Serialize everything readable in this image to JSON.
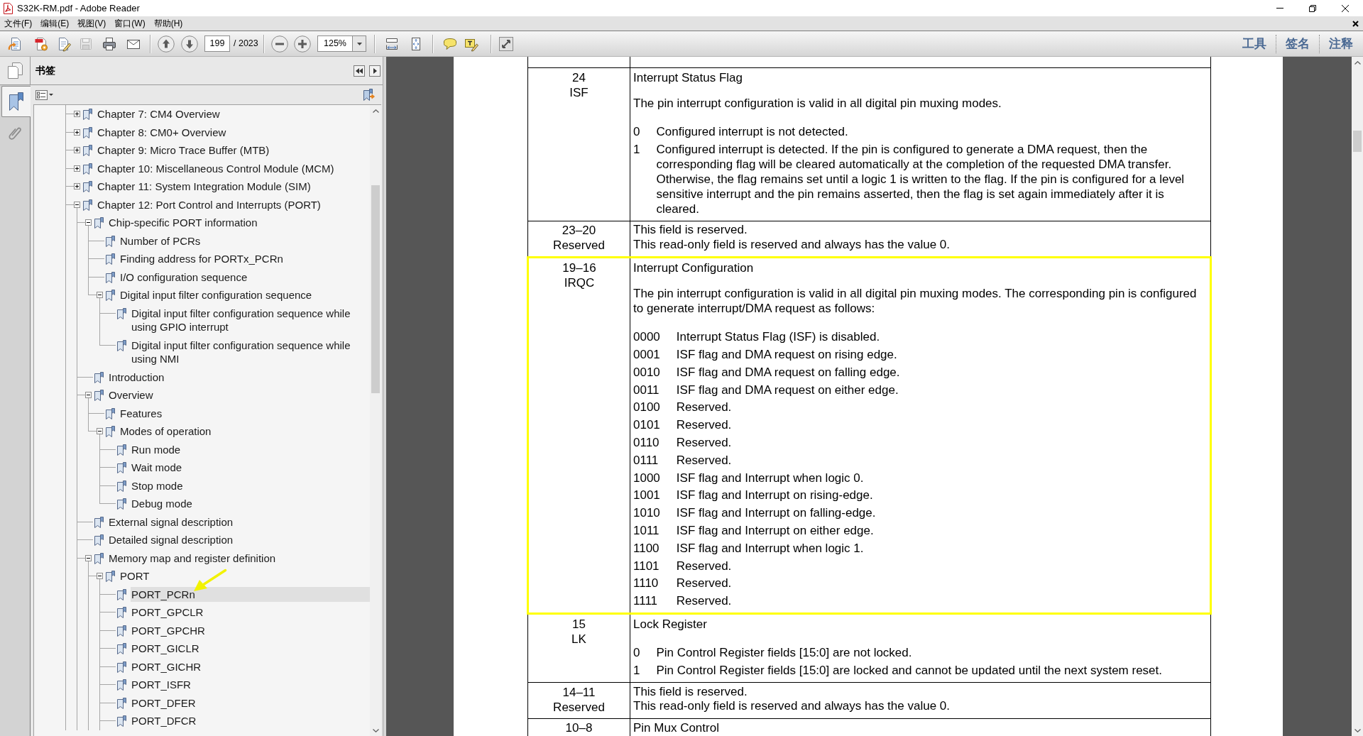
{
  "window": {
    "title": "S32K-RM.pdf - Adobe Reader"
  },
  "menu": [
    "文件(F)",
    "编辑(E)",
    "视图(V)",
    "窗口(W)",
    "帮助(H)"
  ],
  "toolbar": {
    "save": {
      "disabled": true
    },
    "page": "199",
    "page_count": "/ 2023",
    "zoom": "125%",
    "panes": [
      "工具",
      "签名",
      "注释"
    ]
  },
  "sidebar": {
    "title": "书签",
    "tabs": [
      {
        "kind": "pages",
        "selected": false
      },
      {
        "kind": "bookmarks",
        "selected": true
      },
      {
        "kind": "attachments",
        "selected": false
      }
    ],
    "bookmarks": [
      {
        "label": "Chapter 7: CM4 Overview",
        "expanded": false,
        "selected": false
      },
      {
        "label": "Chapter 8: CM0+ Overview",
        "expanded": false,
        "selected": false
      },
      {
        "label": "Chapter 9: Micro Trace Buffer (MTB)",
        "expanded": false,
        "selected": false
      },
      {
        "label": "Chapter 10: Miscellaneous Control Module (MCM)",
        "expanded": false,
        "selected": false
      },
      {
        "label": "Chapter 11: System Integration Module (SIM)",
        "expanded": false,
        "selected": false
      },
      {
        "label": "Chapter 12: Port Control and Interrupts (PORT)",
        "expanded": true,
        "selected": false,
        "children": [
          {
            "label": "Chip-specific PORT information",
            "expanded": true,
            "selected": false,
            "children": [
              {
                "label": "Number of PCRs",
                "selected": false
              },
              {
                "label": "Finding address for PORTx_PCRn",
                "selected": false
              },
              {
                "label": "I/O configuration sequence",
                "selected": false
              },
              {
                "label": "Digital input filter configuration sequence",
                "expanded": true,
                "selected": false,
                "children": [
                  {
                    "label": "Digital input filter configuration sequence while using GPIO interrupt",
                    "selected": false
                  },
                  {
                    "label": "Digital input filter configuration sequence while using NMI",
                    "selected": false
                  }
                ]
              }
            ]
          },
          {
            "label": "Introduction",
            "selected": false
          },
          {
            "label": "Overview",
            "expanded": true,
            "selected": false,
            "children": [
              {
                "label": "Features",
                "selected": false
              },
              {
                "label": "Modes of operation",
                "expanded": true,
                "selected": false,
                "children": [
                  {
                    "label": "Run mode",
                    "selected": false
                  },
                  {
                    "label": "Wait mode",
                    "selected": false
                  },
                  {
                    "label": "Stop mode",
                    "selected": false
                  },
                  {
                    "label": "Debug mode",
                    "selected": false
                  }
                ]
              }
            ]
          },
          {
            "label": "External signal description",
            "selected": false
          },
          {
            "label": "Detailed signal description",
            "selected": false
          },
          {
            "label": "Memory map and register definition",
            "expanded": true,
            "selected": false,
            "children": [
              {
                "label": "PORT",
                "expanded": true,
                "selected": false,
                "children": [
                  {
                    "label": "PORT_PCRn",
                    "selected": true
                  },
                  {
                    "label": "PORT_GPCLR",
                    "selected": false
                  },
                  {
                    "label": "PORT_GPCHR",
                    "selected": false
                  },
                  {
                    "label": "PORT_GICLR",
                    "selected": false
                  },
                  {
                    "label": "PORT_GICHR",
                    "selected": false
                  },
                  {
                    "label": "PORT_ISFR",
                    "selected": false
                  },
                  {
                    "label": "PORT_DFER",
                    "selected": false
                  },
                  {
                    "label": "PORT_DFCR",
                    "selected": false
                  }
                ]
              }
            ]
          }
        ]
      }
    ]
  },
  "document": {
    "rows": [
      {
        "kind": "field",
        "bits": "24",
        "name": "ISF",
        "highlighted": false,
        "title": "Interrupt Status Flag",
        "paragraphs": [
          "The pin interrupt configuration is valid in all digital pin muxing modes."
        ],
        "values": [
          {
            "code": "0",
            "text": "Configured interrupt is not detected."
          },
          {
            "code": "1",
            "text": "Configured interrupt is detected. If the pin is configured to generate a DMA request, then the corresponding flag will be cleared automatically at the completion of the requested DMA transfer. Otherwise, the flag remains set until a logic 1 is written to the flag. If the pin is configured for a level sensitive interrupt and the pin remains asserted, then the flag is set again immediately after it is cleared."
          }
        ]
      },
      {
        "kind": "reserved",
        "bits": "23–20",
        "name": "Reserved",
        "highlighted": false,
        "lines": [
          "This field is reserved.",
          "This read-only field is reserved and always has the value 0."
        ]
      },
      {
        "kind": "field",
        "bits": "19–16",
        "name": "IRQC",
        "highlighted": true,
        "title": "Interrupt Configuration",
        "paragraphs": [
          "The pin interrupt configuration is valid in all digital pin muxing modes. The corresponding pin is configured to generate interrupt/DMA request as follows:"
        ],
        "values": [
          {
            "code": "0000",
            "text": "Interrupt Status Flag (ISF) is disabled."
          },
          {
            "code": "0001",
            "text": "ISF flag and DMA request on rising edge."
          },
          {
            "code": "0010",
            "text": "ISF flag and DMA request on falling edge."
          },
          {
            "code": "0011",
            "text": "ISF flag and DMA request on either edge."
          },
          {
            "code": "0100",
            "text": "Reserved."
          },
          {
            "code": "0101",
            "text": "Reserved."
          },
          {
            "code": "0110",
            "text": "Reserved."
          },
          {
            "code": "0111",
            "text": "Reserved."
          },
          {
            "code": "1000",
            "text": "ISF flag and Interrupt when logic 0."
          },
          {
            "code": "1001",
            "text": "ISF flag and Interrupt on rising-edge."
          },
          {
            "code": "1010",
            "text": "ISF flag and Interrupt on falling-edge."
          },
          {
            "code": "1011",
            "text": "ISF flag and Interrupt on either edge."
          },
          {
            "code": "1100",
            "text": "ISF flag and Interrupt when logic 1."
          },
          {
            "code": "1101",
            "text": "Reserved."
          },
          {
            "code": "1110",
            "text": "Reserved."
          },
          {
            "code": "1111",
            "text": "Reserved."
          }
        ]
      },
      {
        "kind": "field",
        "bits": "15",
        "name": "LK",
        "highlighted": false,
        "title": "Lock Register",
        "values": [
          {
            "code": "0",
            "text": "Pin Control Register fields [15:0] are not locked."
          },
          {
            "code": "1",
            "text": "Pin Control Register fields [15:0] are locked and cannot be updated until the next system reset."
          }
        ]
      },
      {
        "kind": "reserved",
        "bits": "14–11",
        "name": "Reserved",
        "highlighted": false,
        "lines": [
          "This field is reserved.",
          "This read-only field is reserved and always has the value 0."
        ]
      },
      {
        "kind": "field",
        "bits": "10–8",
        "highlighted": false,
        "title": "Pin Mux Control"
      }
    ]
  }
}
